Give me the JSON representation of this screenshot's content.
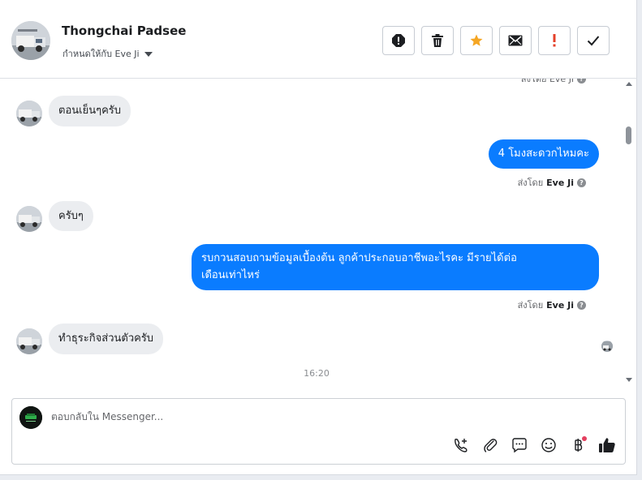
{
  "header": {
    "contact_name": "Thongchai Padsee",
    "assign_label": "กำหนดให้กับ Eve Ji",
    "actions": [
      "mark-spam-icon",
      "delete-icon",
      "star-icon",
      "mark-unread-icon",
      "follow-up-icon",
      "mark-done-icon"
    ]
  },
  "conversation": {
    "top_clipped_text": "ส่งโดย Eve Ji",
    "messages": [
      {
        "from": "contact",
        "text": "ตอนเย็นๆครับ"
      },
      {
        "from": "page",
        "text": "4 โมงสะดวกไหมคะ",
        "sent_by_prefix": "ส่งโดย",
        "sent_by_name": "Eve Ji"
      },
      {
        "from": "contact",
        "text": "ครับๆ"
      },
      {
        "from": "page",
        "lines": [
          "รบกวนสอบถามข้อมูลเบื้องต้น ลูกค้าประกอบอาชีพอะไรคะ มีรายได้ต่อ",
          "เดือนเท่าไหร่"
        ],
        "sent_by_prefix": "ส่งโดย",
        "sent_by_name": "Eve Ji"
      },
      {
        "from": "contact",
        "text": "ทำธุระกิจส่วนตัวครับ"
      }
    ],
    "timestamp": "16:20"
  },
  "composer": {
    "placeholder": "ตอบกลับใน Messenger...",
    "value": "",
    "tools": [
      "phone-add-icon",
      "attachment-icon",
      "saved-reply-icon",
      "emoji-icon",
      "baht-payment-icon",
      "thumbs-up-icon"
    ]
  },
  "colors": {
    "outgoing_bubble": "#0a7cff",
    "incoming_bubble": "#ebedf0",
    "star": "#f5a623",
    "follow_up": "#e4402a"
  }
}
